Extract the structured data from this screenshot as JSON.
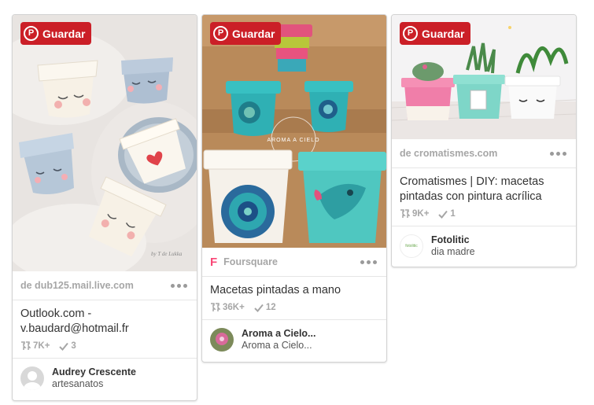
{
  "save_label": "Guardar",
  "colors": {
    "save_button": "#cb1f27",
    "foursquare": "#f94877"
  },
  "pins": [
    {
      "source": "de dub125.mail.live.com",
      "description": "Outlook.com - v.baudard@hotmail.fr",
      "repins": "7K+",
      "likes": "3",
      "user": "Audrey Crescente",
      "board": "artesanatos",
      "image_caption": "by T de Lukka"
    },
    {
      "source": "Foursquare",
      "description": "Macetas pintadas a mano",
      "repins": "36K+",
      "likes": "12",
      "user": "Aroma a Cielo...",
      "board": "Aroma a Cielo...",
      "image_watermark": "AROMA A CIELO"
    },
    {
      "source": "de cromatismes.com",
      "description": "Cromatismes | DIY: macetas pintadas con pintura acrílica",
      "repins": "9K+",
      "likes": "1",
      "user": "Fotolitic",
      "board": "dia madre",
      "avatar_text": "fotolitic"
    }
  ]
}
